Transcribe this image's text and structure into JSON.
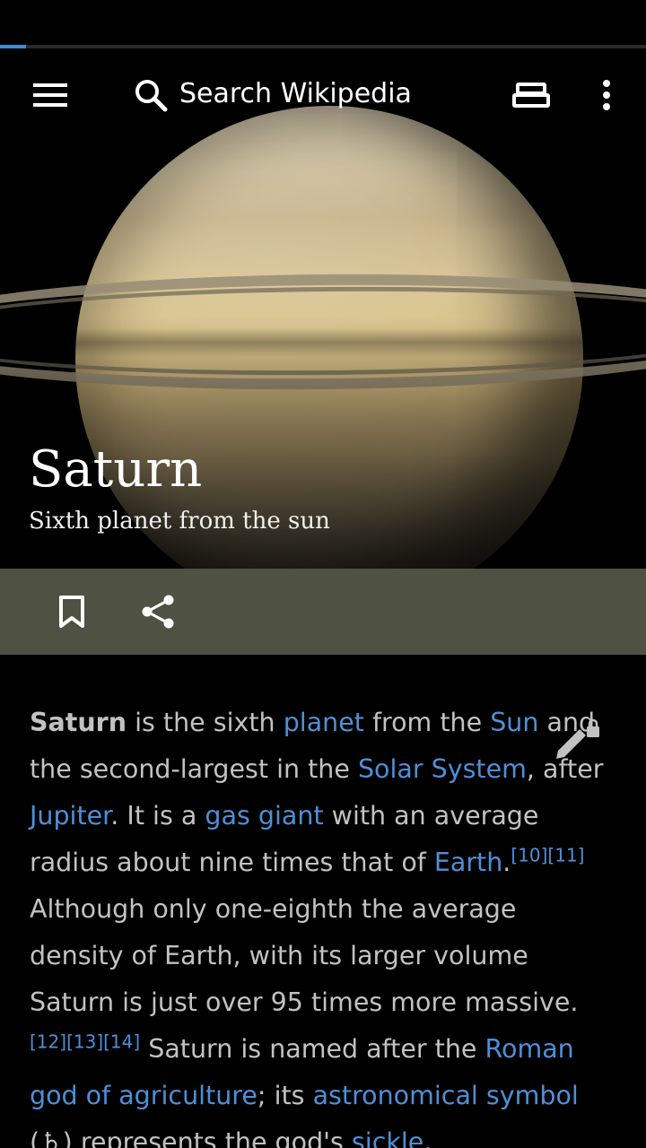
{
  "toolbar": {
    "search_placeholder": "Search Wikipedia"
  },
  "progress": {
    "fraction": 0.04
  },
  "article": {
    "title": "Saturn",
    "subtitle": "Sixth planet from the sun",
    "paragraph": [
      {
        "t": "b",
        "text": "Saturn"
      },
      {
        "t": "s",
        "text": " is the sixth "
      },
      {
        "t": "a",
        "text": "planet"
      },
      {
        "t": "s",
        "text": " from the "
      },
      {
        "t": "a",
        "text": "Sun"
      },
      {
        "t": "s",
        "text": " and the second-largest in the "
      },
      {
        "t": "a",
        "text": "Solar System"
      },
      {
        "t": "s",
        "text": ", after "
      },
      {
        "t": "a",
        "text": "Jupiter"
      },
      {
        "t": "s",
        "text": ". It is a "
      },
      {
        "t": "a",
        "text": "gas giant"
      },
      {
        "t": "s",
        "text": " with an average radius about nine times that of "
      },
      {
        "t": "a",
        "text": "Earth"
      },
      {
        "t": "s",
        "text": "."
      },
      {
        "t": "sup",
        "text": "[10]"
      },
      {
        "t": "sup",
        "text": "[11]"
      },
      {
        "t": "s",
        "text": " Although only one-eighth the average density of Earth, with its larger volume Saturn is just over 95 times more massive."
      },
      {
        "t": "sup",
        "text": "[12]"
      },
      {
        "t": "sup",
        "text": "[13]"
      },
      {
        "t": "sup",
        "text": "[14]"
      },
      {
        "t": "s",
        "text": " Saturn is named after the "
      },
      {
        "t": "a",
        "text": "Roman god of agriculture"
      },
      {
        "t": "s",
        "text": "; its "
      },
      {
        "t": "a",
        "text": "astronomical symbol"
      },
      {
        "t": "s",
        "text": " (♄) represents the god's "
      },
      {
        "t": "a",
        "text": "sickle"
      },
      {
        "t": "s",
        "text": "."
      }
    ]
  },
  "icons": {
    "menu": "menu-icon",
    "search": "search-icon",
    "reading_lists": "reading-lists-icon",
    "overflow": "overflow-menu-icon",
    "bookmark": "bookmark-icon",
    "share": "share-icon",
    "edit_locked": "edit-locked-icon"
  },
  "colors": {
    "link": "#4f8fd6",
    "body_text": "#c2c2c2",
    "action_bar": "#4f5142",
    "progress": "#3b8fd6"
  }
}
